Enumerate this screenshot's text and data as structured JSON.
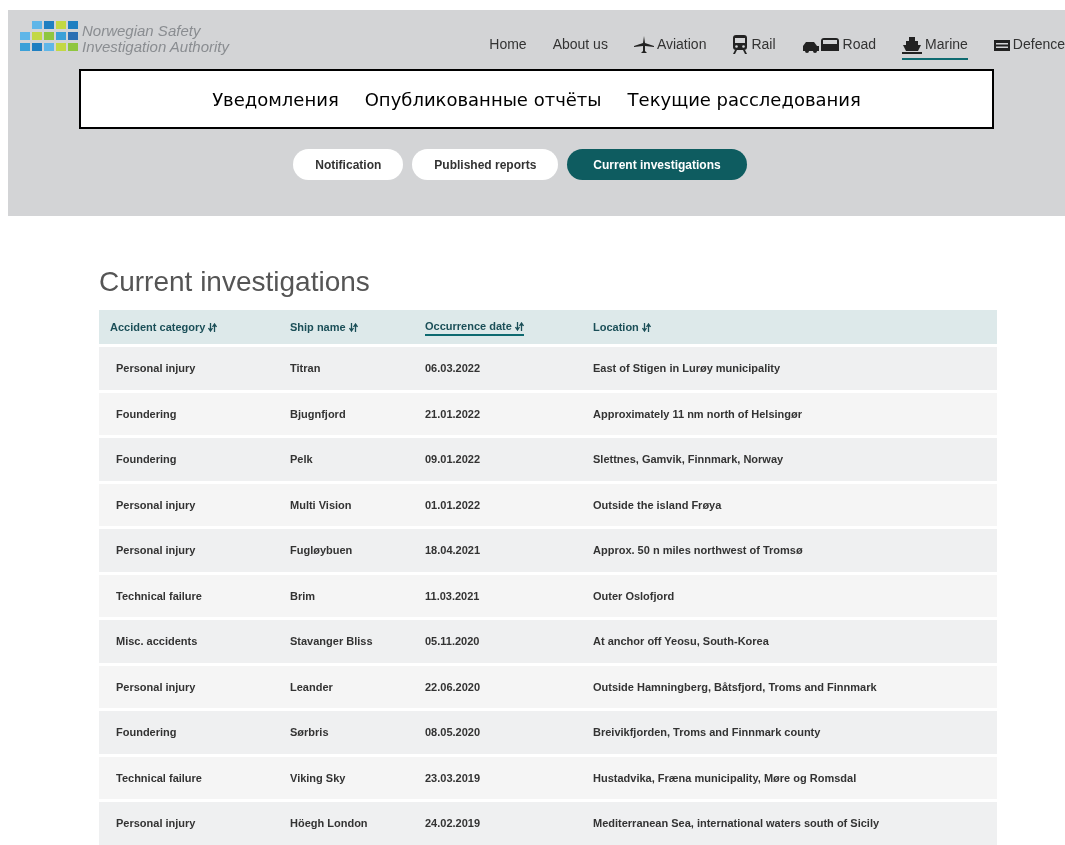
{
  "header": {
    "logo_lines": [
      "Norwegian Safety",
      "Investigation Authority"
    ],
    "nav": [
      {
        "label": "Home",
        "kind": "text",
        "selected": false
      },
      {
        "label": "About us",
        "kind": "text",
        "selected": false
      },
      {
        "label": "Aviation",
        "kind": "plane",
        "selected": false
      },
      {
        "label": "Rail",
        "kind": "train",
        "selected": false
      },
      {
        "label": "Road",
        "kind": "cars",
        "selected": false
      },
      {
        "label": "Marine",
        "kind": "ship",
        "selected": true
      },
      {
        "label": "Defence",
        "kind": "vehicle",
        "selected": false
      }
    ]
  },
  "translation_box": [
    "Уведомления",
    "Опубликованные отчёты",
    "Текущие расследования"
  ],
  "filter_buttons": [
    {
      "label": "Notification",
      "selected": false
    },
    {
      "label": "Published reports",
      "selected": false
    },
    {
      "label": "Current investigations",
      "selected": true
    }
  ],
  "heading": "Current investigations",
  "table": {
    "columns": [
      {
        "label": "Accident category",
        "sorted": false
      },
      {
        "label": "Ship name",
        "sorted": false
      },
      {
        "label": "Occurrence date",
        "sorted": true
      },
      {
        "label": "Location",
        "sorted": false
      }
    ],
    "rows": [
      [
        "Personal injury",
        "Titran",
        "06.03.2022",
        "East of Stigen in Lurøy municipality"
      ],
      [
        "Foundering",
        "Bjugnfjord",
        "21.01.2022",
        "Approximately 11 nm north of Helsingør"
      ],
      [
        "Foundering",
        "Pelk",
        "09.01.2022",
        "Slettnes, Gamvik, Finnmark, Norway"
      ],
      [
        "Personal injury",
        "Multi Vision",
        "01.01.2022",
        "Outside the island Frøya"
      ],
      [
        "Personal injury",
        "Fugløybuen",
        "18.04.2021",
        "Approx. 50 n miles northwest of Tromsø"
      ],
      [
        "Technical failure",
        "Brim",
        "11.03.2021",
        "Outer Oslofjord"
      ],
      [
        "Misc. accidents",
        "Stavanger Bliss",
        "05.11.2020",
        "At anchor off Yeosu, South-Korea"
      ],
      [
        "Personal injury",
        "Leander",
        "22.06.2020",
        "Outside Hamningberg, Båtsfjord, Troms and Finnmark"
      ],
      [
        "Foundering",
        "Sørbris",
        "08.05.2020",
        "Breivikfjorden, Troms and Finnmark county"
      ],
      [
        "Technical failure",
        "Viking Sky",
        "23.03.2019",
        "Hustadvika, Fræna municipality, Møre og Romsdal"
      ],
      [
        "Personal injury",
        "Höegh London",
        "24.02.2019",
        "Mediterranean Sea, international waters south of Sicily"
      ]
    ]
  }
}
